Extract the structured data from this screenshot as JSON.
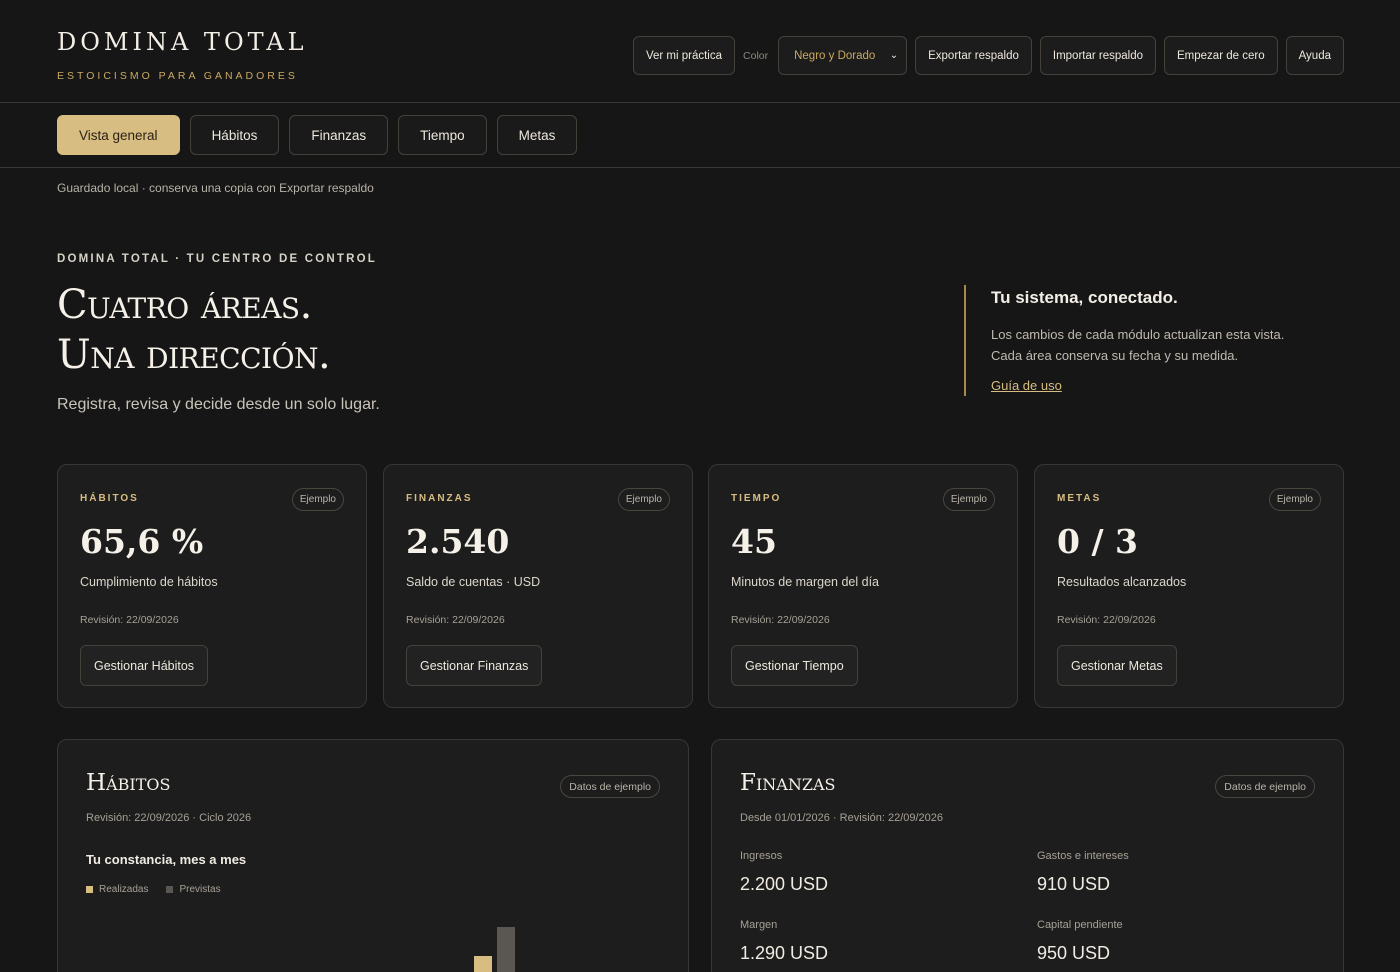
{
  "brand": {
    "title": "DOMINA TOTAL",
    "subtitle": "ESTOICISMO PARA GANADORES"
  },
  "toolbar": {
    "view_practice": "Ver mi práctica",
    "color_label": "Color",
    "color_value": "Negro y Dorado",
    "export": "Exportar respaldo",
    "import": "Importar respaldo",
    "reset": "Empezar de cero",
    "help": "Ayuda"
  },
  "tabs": [
    {
      "label": "Vista general",
      "active": true
    },
    {
      "label": "Hábitos",
      "active": false
    },
    {
      "label": "Finanzas",
      "active": false
    },
    {
      "label": "Tiempo",
      "active": false
    },
    {
      "label": "Metas",
      "active": false
    }
  ],
  "save_note": "Guardado local · conserva una copia con Exportar respaldo",
  "hero": {
    "eyebrow": "DOMINA TOTAL · TU CENTRO DE CONTROL",
    "title_line1": "Cuatro áreas.",
    "title_line2": "Una dirección.",
    "subtitle": "Registra, revisa y decide desde un solo lugar."
  },
  "side": {
    "title": "Tu sistema, conectado.",
    "line1": "Los cambios de cada módulo actualizan esta vista.",
    "line2": "Cada área conserva su fecha y su medida.",
    "link": "Guía de uso"
  },
  "cards": [
    {
      "label": "HÁBITOS",
      "pill": "Ejemplo",
      "value": "65,6 %",
      "desc": "Cumplimiento de hábitos",
      "rev": "Revisión: 22/09/2026",
      "button": "Gestionar Hábitos"
    },
    {
      "label": "FINANZAS",
      "pill": "Ejemplo",
      "value": "2.540",
      "desc": "Saldo de cuentas · USD",
      "rev": "Revisión: 22/09/2026",
      "button": "Gestionar Finanzas"
    },
    {
      "label": "TIEMPO",
      "pill": "Ejemplo",
      "value": "45",
      "desc": "Minutos de margen del día",
      "rev": "Revisión: 22/09/2026",
      "button": "Gestionar Tiempo"
    },
    {
      "label": "METAS",
      "pill": "Ejemplo",
      "value": "0 / 3",
      "desc": "Resultados alcanzados",
      "rev": "Revisión: 22/09/2026",
      "button": "Gestionar Metas"
    }
  ],
  "habits_panel": {
    "title": "Hábitos",
    "pill": "Datos de ejemplo",
    "meta": "Revisión: 22/09/2026 · Ciclo 2026",
    "heading": "Tu constancia, mes a mes",
    "legend_done": "Realizadas",
    "legend_planned": "Previstas"
  },
  "finance_panel": {
    "title": "Finanzas",
    "pill": "Datos de ejemplo",
    "meta": "Desde 01/01/2026 · Revisión: 22/09/2026",
    "items": [
      {
        "label": "Ingresos",
        "value": "2.200 USD"
      },
      {
        "label": "Gastos e intereses",
        "value": "910 USD"
      },
      {
        "label": "Margen",
        "value": "1.290 USD"
      },
      {
        "label": "Capital pendiente",
        "value": "950 USD"
      }
    ]
  },
  "colors": {
    "accent": "#d8bd82",
    "background": "#161616",
    "card": "#1d1d1d",
    "planned_bar": "#5a5752",
    "done_bar": "#d8bd82"
  }
}
